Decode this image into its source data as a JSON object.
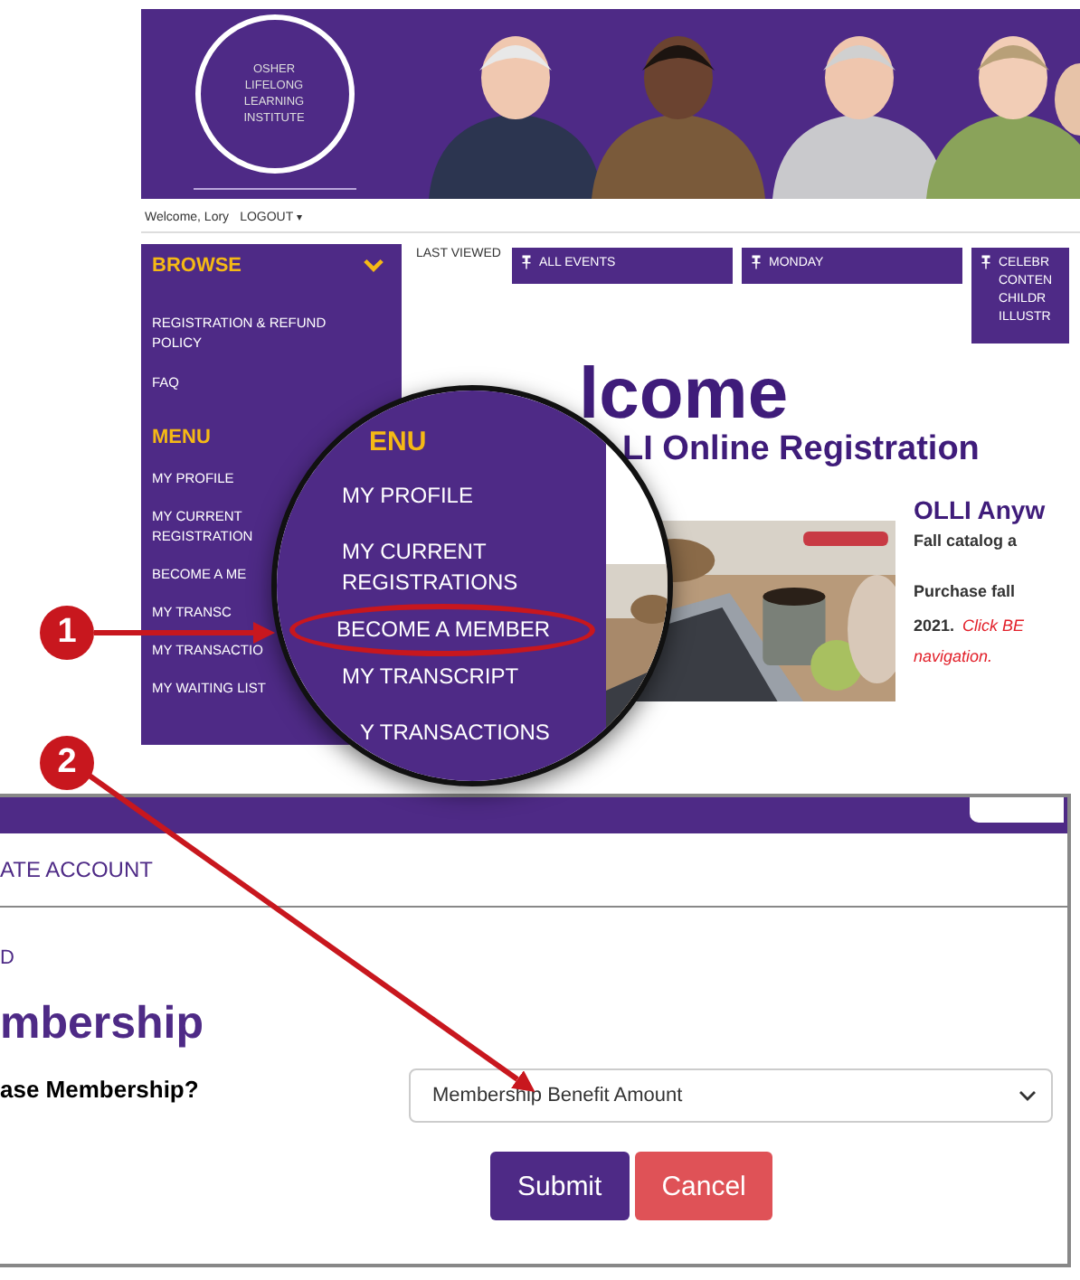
{
  "header": {
    "logo_lines": [
      "OSHER",
      "LIFELONG",
      "LEARNING",
      "INSTITUTE"
    ],
    "photo": {
      "kind": "picture"
    }
  },
  "user_bar": {
    "greeting": "Welcome, Lory",
    "logout": "LOGOUT",
    "logout_caret": "▾"
  },
  "sidebar": {
    "browse_heading": "BROWSE",
    "browse_items": [
      {
        "label": "REGISTRATION & REFUND POLICY"
      },
      {
        "label": "FAQ"
      }
    ],
    "menu_heading": "MENU",
    "menu_items": [
      {
        "label": "MY PROFILE"
      },
      {
        "label": "MY CURRENT REGISTRATION"
      },
      {
        "label": "BECOME A ME"
      },
      {
        "label": "MY TRANSC"
      },
      {
        "label": "MY TRANSACTIO"
      },
      {
        "label": "MY WAITING LIST"
      }
    ]
  },
  "recent": {
    "label": "LAST VIEWED",
    "items": [
      {
        "lines": [
          "ALL EVENTS"
        ]
      },
      {
        "lines": [
          "MONDAY"
        ]
      },
      {
        "lines": [
          "CELEBR",
          "CONTEN",
          "CHILDR",
          "ILLUSTR"
        ]
      }
    ]
  },
  "welcome": {
    "title": "lcome",
    "subtitle": "LI Online Registration"
  },
  "feature": {
    "photo": {
      "kind": "picture"
    },
    "heading": "OLLI Anyw",
    "intro": "Fall catalog a",
    "body": "Purchase fall",
    "year": "2021.",
    "link": "Click BE",
    "note": "navigation."
  },
  "magnifier": {
    "heading": "ENU",
    "items": [
      {
        "label": "MY PROFILE",
        "circled": false
      },
      {
        "label": "MY CURRENT REGISTRATIONS",
        "circled": false
      },
      {
        "label": "BECOME A MEMBER",
        "circled": true
      },
      {
        "label": "MY TRANSCRIPT",
        "circled": false
      },
      {
        "label": "Y TRANSACTIONS",
        "circled": false
      }
    ]
  },
  "callouts": [
    {
      "number": "1"
    },
    {
      "number": "2"
    }
  ],
  "form": {
    "tab": "ATE ACCOUNT",
    "breadcrumb": "D",
    "title": "mbership",
    "question": "ase Membership?",
    "select": {
      "value": "Membership Benefit Amount"
    },
    "buttons": [
      {
        "label": "Submit",
        "kind": "primary"
      },
      {
        "label": "Cancel",
        "kind": "danger"
      }
    ]
  }
}
